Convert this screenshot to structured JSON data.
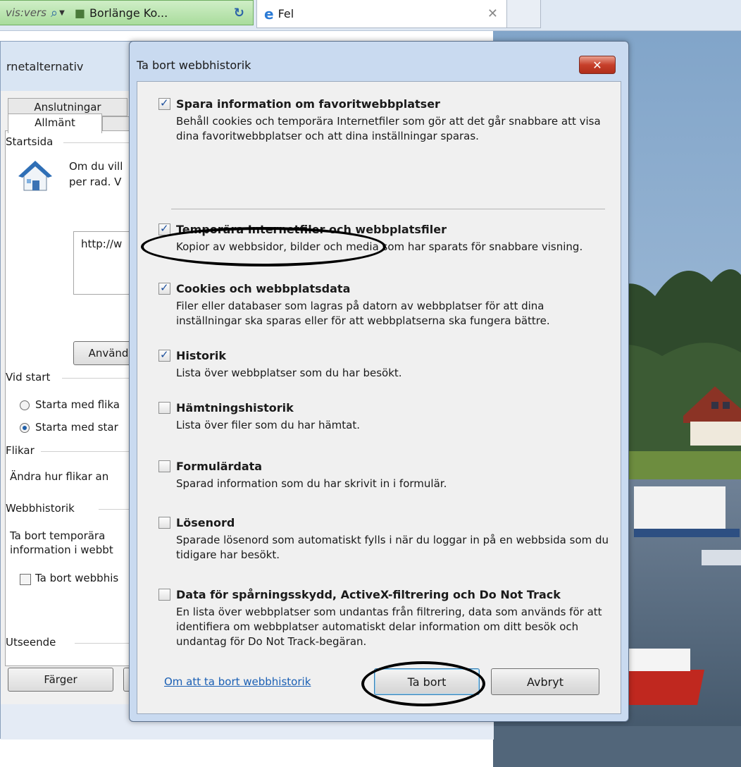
{
  "browser": {
    "address_partial": "vis:vers",
    "site_tab": "Borlänge Ko...",
    "tab_title": "Fel",
    "icons": [
      "search-icon",
      "refresh-icon",
      "ie-icon",
      "close-icon"
    ]
  },
  "options_window": {
    "title": "rnetalternativ",
    "tab_connections": "Anslutningar",
    "tab_general": "Allmänt",
    "group_startpage": "Startsida",
    "startpage_text_1": "Om du vill",
    "startpage_text_2": "per rad. V",
    "url_value": "http://w",
    "use_button": "Använd",
    "group_startup": "Vid start",
    "radio_tabs": "Starta med flika",
    "radio_start": "Starta med star",
    "group_tabs": "Flikar",
    "tabs_text": "Ändra hur flikar an",
    "group_history": "Webbhistorik",
    "history_text_1": "Ta bort temporära",
    "history_text_2": "information i webbt",
    "history_checkbox": "Ta bort webbhis",
    "group_appearance": "Utseende",
    "colors_button": "Färger"
  },
  "dialog": {
    "title": "Ta bort webbhistorik",
    "close_glyph": "✕",
    "options": [
      {
        "checked": true,
        "title": "Spara information om favoritwebbplatser",
        "desc": "Behåll cookies och temporära Internetfiler som gör att det går snabbare att visa dina favoritwebbplatser och att dina inställningar sparas."
      },
      {
        "checked": true,
        "title": "Temporära Internetfiler och webbplatsfiler",
        "desc": "Kopior av webbsidor, bilder och media som har sparats för snabbare visning."
      },
      {
        "checked": true,
        "title": "Cookies och webbplatsdata",
        "desc": "Filer eller databaser som lagras på datorn av webbplatser för att dina inställningar ska sparas eller för att webbplatserna ska fungera bättre."
      },
      {
        "checked": true,
        "title": "Historik",
        "desc": "Lista över webbplatser som du har besökt."
      },
      {
        "checked": false,
        "title": "Hämtningshistorik",
        "desc": "Lista över filer som du har hämtat."
      },
      {
        "checked": false,
        "title": "Formulärdata",
        "desc": "Sparad information som du har skrivit in i formulär."
      },
      {
        "checked": false,
        "title": "Lösenord",
        "desc": "Sparade lösenord som automatiskt fylls i när du loggar in på en webbsida som du tidigare har besökt."
      },
      {
        "checked": false,
        "title": "Data för spårningsskydd, ActiveX-filtrering och Do Not Track",
        "desc": "En lista över webbplatser som undantas från filtrering, data som används för att identifiera om webbplatser automatiskt delar information om ditt besök och undantag för Do Not Track-begäran."
      }
    ],
    "link": "Om att ta bort webbhistorik",
    "delete_button": "Ta bort",
    "cancel_button": "Avbryt"
  }
}
